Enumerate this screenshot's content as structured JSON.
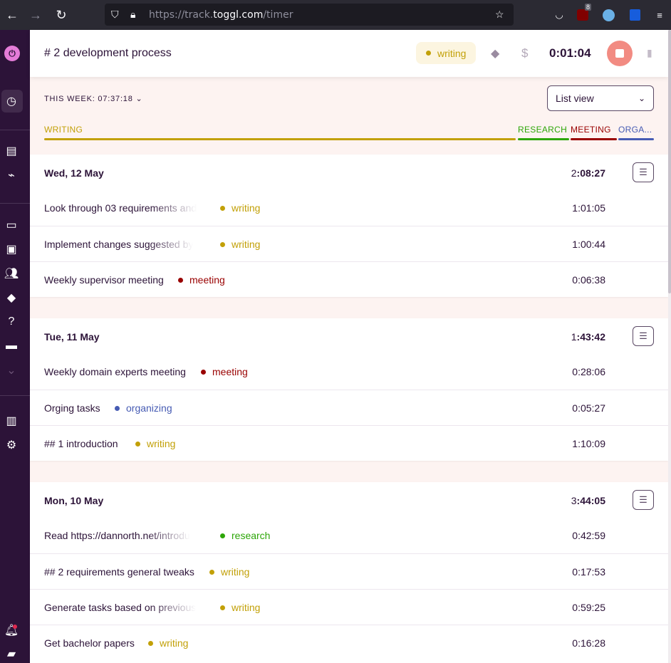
{
  "browser": {
    "url_prefix": "https://track.",
    "url_domain": "toggl.com",
    "url_path": "/timer",
    "ublock_badge": "8"
  },
  "timer": {
    "description": "# 2 development process",
    "project": "writing",
    "project_color": "#c2a007",
    "elapsed": "0:01:04"
  },
  "week": {
    "label": "THIS WEEK: 07:37:18",
    "view": "List view"
  },
  "project_bar": [
    {
      "name": "WRITING",
      "color": "#c2a007"
    },
    {
      "name": "RESEARCH",
      "color": "#2da608"
    },
    {
      "name": "MEETING",
      "color": "#990000"
    },
    {
      "name": "ORGA...",
      "color": "#465bb3"
    }
  ],
  "days": [
    {
      "date": "Wed, 12 May",
      "total_h": "2",
      "total_rest": ":08:27",
      "entries": [
        {
          "desc": "Look through 03 requirements and",
          "project": "writing",
          "color": "#c2a007",
          "duration": "1:01:05"
        },
        {
          "desc": "Implement changes suggested by",
          "project": "writing",
          "color": "#c2a007",
          "duration": "1:00:44"
        },
        {
          "desc": "Weekly supervisor meeting",
          "project": "meeting",
          "color": "#990000",
          "duration": "0:06:38"
        }
      ]
    },
    {
      "date": "Tue, 11 May",
      "total_h": "1",
      "total_rest": ":43:42",
      "entries": [
        {
          "desc": "Weekly domain experts meeting",
          "project": "meeting",
          "color": "#990000",
          "duration": "0:28:06"
        },
        {
          "desc": "Orging tasks",
          "project": "organizing",
          "color": "#465bb3",
          "duration": "0:05:27"
        },
        {
          "desc": "## 1 introduction",
          "project": "writing",
          "color": "#c2a007",
          "duration": "1:10:09"
        }
      ]
    },
    {
      "date": "Mon, 10 May",
      "total_h": "3",
      "total_rest": ":44:05",
      "entries": [
        {
          "desc": "Read https://dannorth.net/introdu",
          "project": "research",
          "color": "#2da608",
          "duration": "0:42:59"
        },
        {
          "desc": "## 2 requirements general tweaks",
          "project": "writing",
          "color": "#c2a007",
          "duration": "0:17:53"
        },
        {
          "desc": "Generate tasks based on previous",
          "project": "writing",
          "color": "#c2a007",
          "duration": "0:59:25"
        },
        {
          "desc": "Get bachelor papers",
          "project": "writing",
          "color": "#c2a007",
          "duration": "0:16:28"
        }
      ]
    }
  ]
}
